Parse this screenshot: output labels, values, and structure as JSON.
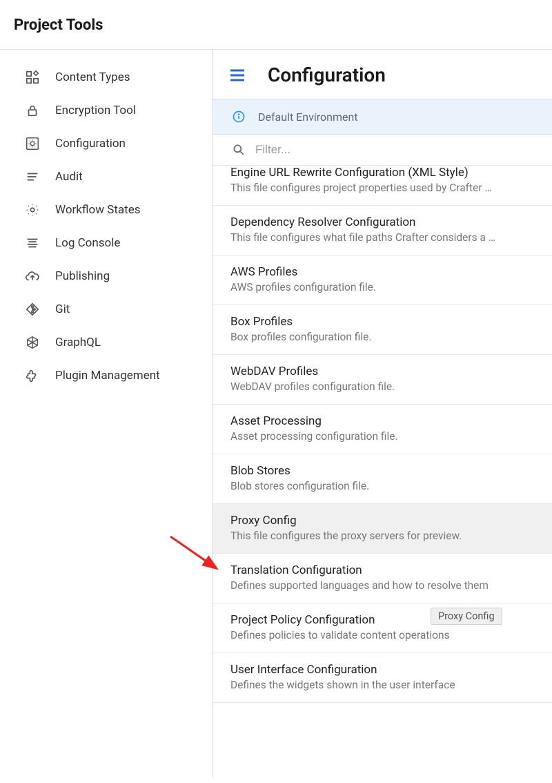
{
  "header": {
    "title": "Project Tools"
  },
  "sidebar": {
    "items": [
      {
        "label": "Content Types"
      },
      {
        "label": "Encryption Tool"
      },
      {
        "label": "Configuration"
      },
      {
        "label": "Audit"
      },
      {
        "label": "Workflow States"
      },
      {
        "label": "Log Console"
      },
      {
        "label": "Publishing"
      },
      {
        "label": "Git"
      },
      {
        "label": "GraphQL"
      },
      {
        "label": "Plugin Management"
      }
    ]
  },
  "main": {
    "title": "Configuration",
    "environment": "Default Environment",
    "filter_placeholder": "Filter...",
    "tooltip": "Proxy Config",
    "items": [
      {
        "title": "Engine URL Rewrite Configuration (XML Style)",
        "desc": "This file configures project properties used by Crafter …"
      },
      {
        "title": "Dependency Resolver Configuration",
        "desc": "This file configures what file paths Crafter considers a …"
      },
      {
        "title": "AWS Profiles",
        "desc": "AWS profiles configuration file."
      },
      {
        "title": "Box Profiles",
        "desc": "Box profiles configuration file."
      },
      {
        "title": "WebDAV Profiles",
        "desc": "WebDAV profiles configuration file."
      },
      {
        "title": "Asset Processing",
        "desc": "Asset processing configuration file."
      },
      {
        "title": "Blob Stores",
        "desc": "Blob stores configuration file."
      },
      {
        "title": "Proxy Config",
        "desc": "This file configures the proxy servers for preview."
      },
      {
        "title": "Translation Configuration",
        "desc": "Defines supported languages and how to resolve them"
      },
      {
        "title": "Project Policy Configuration",
        "desc": "Defines policies to validate content operations"
      },
      {
        "title": "User Interface Configuration",
        "desc": "Defines the widgets shown in the user interface"
      }
    ]
  }
}
